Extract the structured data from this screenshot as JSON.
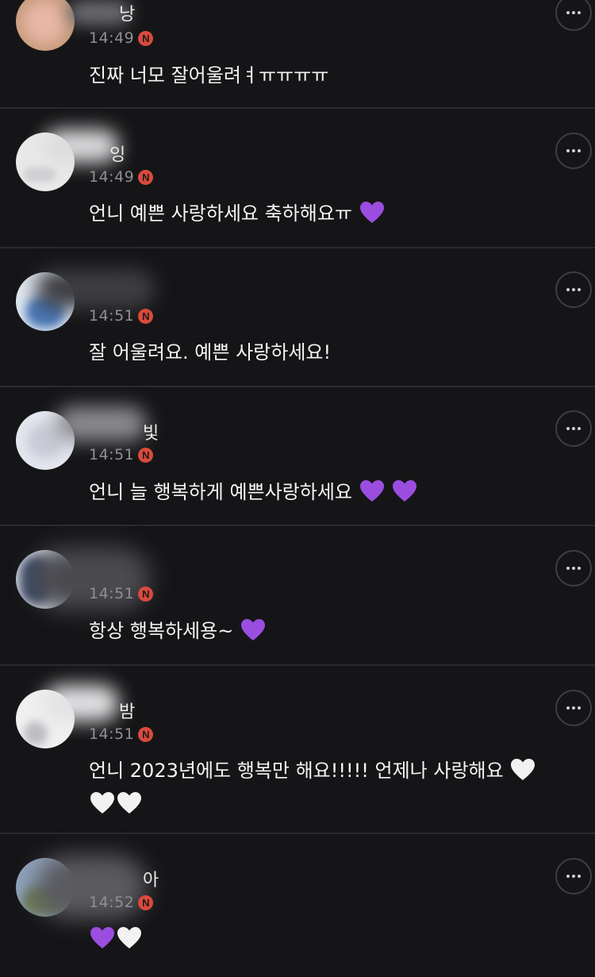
{
  "comments": [
    {
      "name_fragment": "낭",
      "time": "14:49",
      "badge": "N",
      "text": "진짜 너모 잘어울려ㅕㅠㅠㅠㅠ",
      "hearts": [],
      "avatar_icon": "avatar-image"
    },
    {
      "name_fragment": "잉",
      "time": "14:49",
      "badge": "N",
      "text": "언니 예쁜 사랑하세요 축하해요ㅠ",
      "hearts": [
        "purple"
      ],
      "avatar_icon": "avatar-image"
    },
    {
      "name_fragment": "",
      "time": "14:51",
      "badge": "N",
      "text": "잘 어울려요. 예쁜 사랑하세요!",
      "hearts": [],
      "avatar_icon": "avatar-image"
    },
    {
      "name_fragment": "빛",
      "time": "14:51",
      "badge": "N",
      "text": "언니 늘 행복하게 예쁜사랑하세요",
      "hearts": [
        "purple",
        "purple"
      ],
      "avatar_icon": "avatar-image"
    },
    {
      "name_fragment": "",
      "time": "14:51",
      "badge": "N",
      "text": "항상 행복하세용~",
      "hearts": [
        "purple"
      ],
      "avatar_icon": "avatar-image"
    },
    {
      "name_fragment": "밤",
      "time": "14:51",
      "badge": "N",
      "text": "언니 2023년에도 행복만 해요!!!!! 언제나 사랑해요",
      "hearts": [
        "white",
        "white",
        "white"
      ],
      "avatar_icon": "avatar-image"
    },
    {
      "name_fragment": "아",
      "time": "14:52",
      "badge": "N",
      "text": "",
      "hearts": [
        "purple",
        "white"
      ],
      "avatar_icon": "avatar-image"
    }
  ],
  "colors": {
    "background": "#151517",
    "divider": "#2a2a2d",
    "timestamp": "#8f8f94",
    "new_badge": "#d94a3c",
    "heart_purple": "#9b4de0",
    "heart_white": "#f2f2f2"
  },
  "icons": {
    "more": "more-options-icon",
    "new": "new-badge-icon",
    "heart": "heart-icon"
  }
}
